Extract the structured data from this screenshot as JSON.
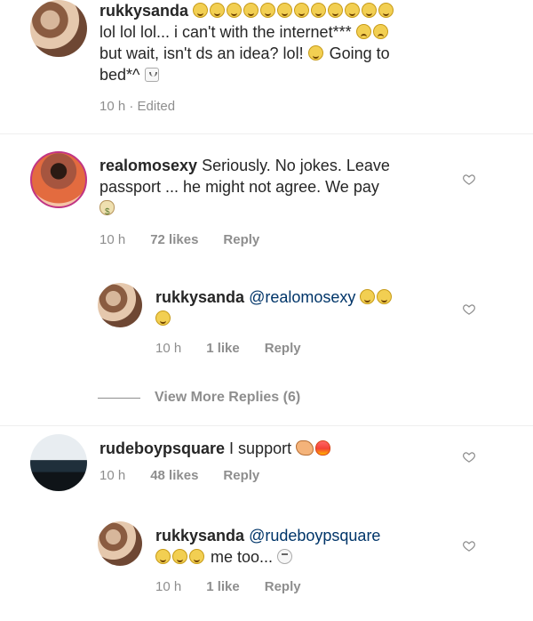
{
  "comments": [
    {
      "username": "rukkysanda",
      "line2": "lol lol lol... i can't with the internet***",
      "line3_a": "but wait, isn't ds an idea? lol!",
      "line3_b": "Going to",
      "line4": "bed*^",
      "time": "10 h · Edited"
    },
    {
      "username": "realomosexy",
      "text_1": "Seriously. No jokes. Leave",
      "text_2": "passport ... he might not agree. We pay",
      "time": "10 h",
      "likes": "72 likes",
      "reply": "Reply"
    },
    {
      "username": "rukkysanda",
      "mention": "@realomosexy",
      "time": "10 h",
      "likes": "1 like",
      "reply": "Reply"
    },
    {
      "view_more": "View More Replies (6)"
    },
    {
      "username": "rudeboypsquare",
      "text": "I support",
      "time": "10 h",
      "likes": "48 likes",
      "reply": "Reply"
    },
    {
      "username": "rukkysanda",
      "mention": "@rudeboypsquare",
      "text": "me too...",
      "time": "10 h",
      "likes": "1 like",
      "reply": "Reply"
    }
  ],
  "icons": {
    "heart": "heart-icon",
    "laughing": "laughing-emoji-icon",
    "sad": "sad-emoji-icon",
    "moneybag": "moneybag-emoji-icon",
    "flame": "fire-emoji-icon",
    "flex": "flexed-biceps-emoji-icon",
    "sleep": "sleeping-emoji-icon",
    "skull": "skull-emoji-icon"
  }
}
